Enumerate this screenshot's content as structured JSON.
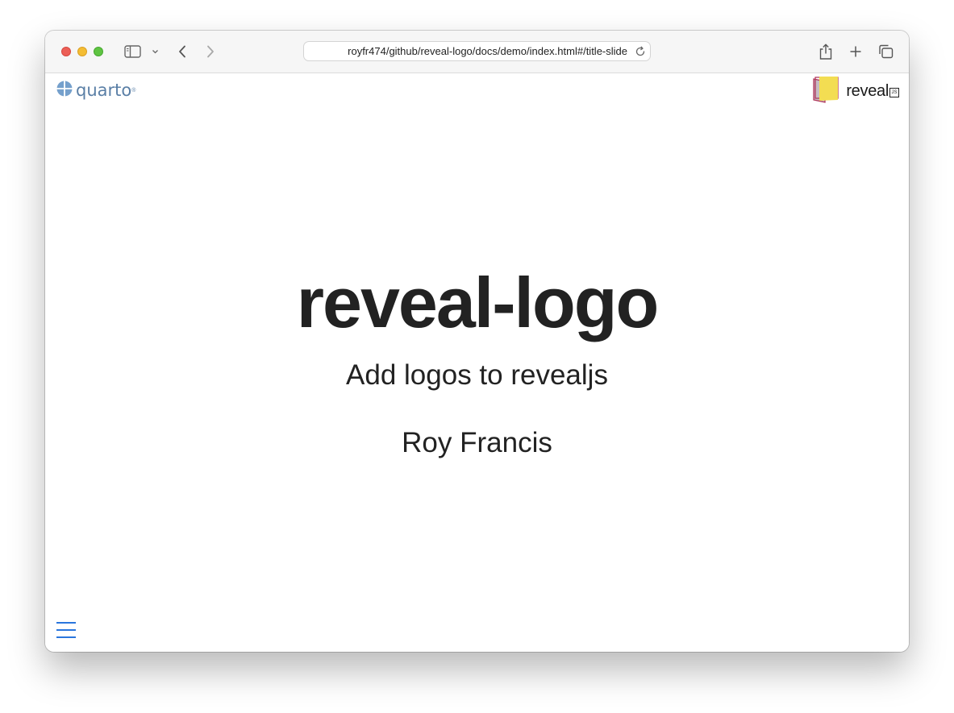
{
  "browser": {
    "url": "royfr474/github/reveal-logo/docs/demo/index.html#/title-slide"
  },
  "slide": {
    "title": "reveal-logo",
    "subtitle": "Add logos to revealjs",
    "author": "Roy Francis"
  },
  "logos": {
    "left": {
      "wordmark": "quarto",
      "registered": "®"
    },
    "right": {
      "wordmark": "reveal",
      "suffix": "JS"
    }
  },
  "colors": {
    "quarto_blue": "#5a7fa6",
    "reveal_yellow": "#f3dd52",
    "reveal_magenta": "#b0365c",
    "menu_blue": "#2a76dd",
    "text": "#222222"
  },
  "icons": {
    "sidebar": "sidebar-icon",
    "chevron": "chevron-down-icon",
    "back": "back-arrow-icon",
    "forward": "forward-arrow-icon",
    "reload": "reload-icon",
    "share": "share-icon",
    "new_tab": "plus-icon",
    "tabs": "tabs-overview-icon",
    "menu": "hamburger-menu-icon"
  }
}
